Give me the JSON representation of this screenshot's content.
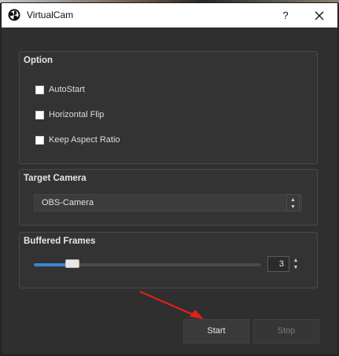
{
  "window": {
    "title": "VirtualCam",
    "help_label": "?"
  },
  "option_group": {
    "title": "Option",
    "checkboxes": [
      {
        "label": "AutoStart",
        "checked": false
      },
      {
        "label": "Horizontal Flip",
        "checked": false
      },
      {
        "label": "Keep Aspect Ratio",
        "checked": false
      }
    ]
  },
  "target_camera_group": {
    "title": "Target Camera",
    "selected_value": "OBS-Camera"
  },
  "buffered_frames_group": {
    "title": "Buffered Frames",
    "slider_fraction": 0.17,
    "spin_value": "3"
  },
  "buttons": {
    "start_label": "Start",
    "stop_label": "Stop"
  },
  "colors": {
    "accent": "#3a86d4",
    "annotation_arrow": "#e0201b"
  },
  "icons": {
    "app": "obs-logo-icon",
    "close": "close-icon"
  }
}
